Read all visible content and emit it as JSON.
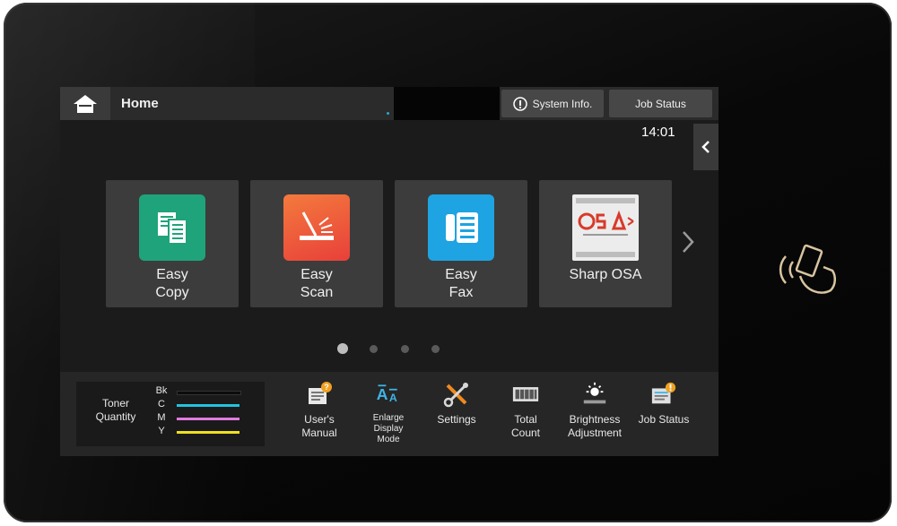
{
  "header": {
    "title": "Home",
    "system_info_label": "System Info.",
    "job_status_label": "Job Status",
    "clock": "14:01"
  },
  "apps": [
    {
      "label_line1": "Easy",
      "label_line2": "Copy",
      "icon": "copy-icon",
      "color": "#1fa37a"
    },
    {
      "label_line1": "Easy",
      "label_line2": "Scan",
      "icon": "scan-icon",
      "color": "#f0583d"
    },
    {
      "label_line1": "Easy",
      "label_line2": "Fax",
      "icon": "fax-icon",
      "color": "#1ea3e3"
    },
    {
      "label_line1": "Sharp OSA",
      "label_line2": "",
      "icon": "osa-icon",
      "color": "#d83a2a"
    }
  ],
  "pagination": {
    "count": 4,
    "active": 1
  },
  "toner": {
    "title_line1": "Toner",
    "title_line2": "Quantity",
    "colors": [
      {
        "letter": "Bk",
        "color": "#111111"
      },
      {
        "letter": "C",
        "color": "#22c3e0"
      },
      {
        "letter": "M",
        "color": "#e07ae0"
      },
      {
        "letter": "Y",
        "color": "#f0e020"
      }
    ]
  },
  "quick_actions": [
    {
      "line1": "User's",
      "line2": "Manual",
      "line3": "",
      "icon": "manual-icon"
    },
    {
      "line1": "Enlarge",
      "line2": "Display",
      "line3": "Mode",
      "icon": "enlarge-text-icon"
    },
    {
      "line1": "Settings",
      "line2": "",
      "line3": "",
      "icon": "settings-icon"
    },
    {
      "line1": "Total",
      "line2": "Count",
      "line3": "",
      "icon": "counter-icon"
    },
    {
      "line1": "Brightness",
      "line2": "Adjustment",
      "line3": "",
      "icon": "brightness-icon"
    },
    {
      "line1": "Job Status",
      "line2": "",
      "line3": "",
      "icon": "job-status-icon"
    }
  ]
}
